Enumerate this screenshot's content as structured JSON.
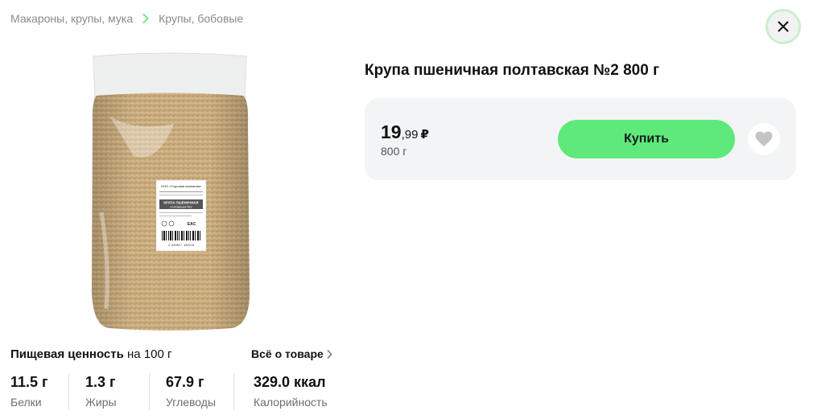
{
  "breadcrumb": {
    "items": [
      "Макароны, крупы, мука",
      "Крупы, бобовые"
    ]
  },
  "icons": {
    "close": "close-icon",
    "breadcrumb_separator": "chevron-right-icon",
    "favorite": "heart-icon",
    "all_about": "chevron-right-icon"
  },
  "product": {
    "title": "Крупа пшеничная полтавская №2 800 г",
    "image_alt": "product-image",
    "package_label": {
      "company": "ООО «Торговая компания»",
      "name_line1": "КРУПА ПШЕНИЧНАЯ",
      "name_line2": "полтавская №2",
      "barcode": "4 620017 460219",
      "mark": "EAC"
    }
  },
  "buy_card": {
    "price_int": "19",
    "price_frac": ",99",
    "currency": "₽",
    "weight": "800 г",
    "buy_label": "Купить"
  },
  "nutrition": {
    "title_bold": "Пищевая ценность",
    "title_rest": " на 100 г",
    "all_about_label": "Всё о товаре",
    "items": [
      {
        "value": "11.5 г",
        "label": "Белки"
      },
      {
        "value": "1.3 г",
        "label": "Жиры"
      },
      {
        "value": "67.9 г",
        "label": "Углеводы"
      },
      {
        "value": "329.0 ккал",
        "label": "Калорийность"
      }
    ]
  },
  "colors": {
    "accent": "#5ee97a",
    "card_bg": "#f3f4f6",
    "close_ring": "#c9f0cf",
    "chevron_green": "#5ee97a",
    "muted_text": "#8a8a8a"
  }
}
